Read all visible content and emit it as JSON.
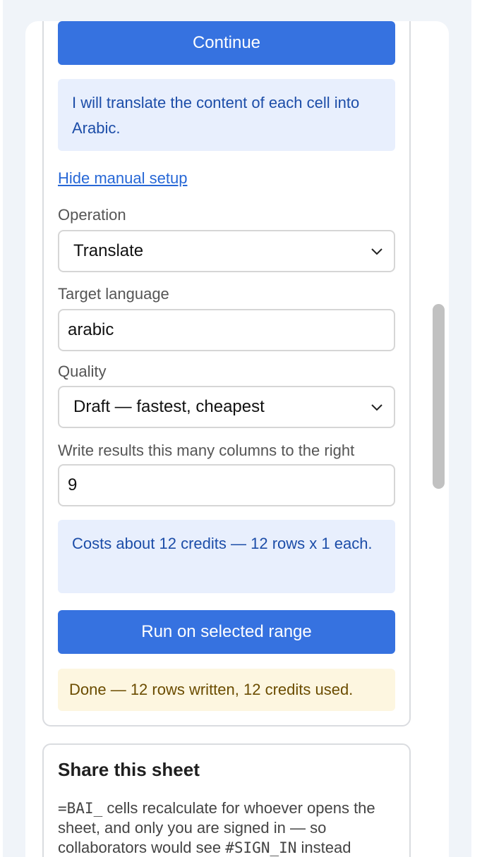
{
  "manual": {
    "continue_label": "Continue",
    "info_text": "I will translate the content of each cell into Arabic.",
    "hide_link": "Hide manual setup",
    "operation_label": "Operation",
    "operation_value": "Translate",
    "target_language_label": "Target language",
    "target_language_value": "arabic",
    "quality_label": "Quality",
    "quality_value": "Draft — fastest, cheapest",
    "offset_label": "Write results this many columns to the right",
    "offset_value": "9",
    "cost_text": "Costs about 12 credits — 12 rows x 1 each.",
    "run_label": "Run on selected range",
    "done_text": "Done — 12 rows written, 12 credits used."
  },
  "share": {
    "title": "Share this sheet",
    "body_code1": "=BAI_",
    "body_text1": " cells recalculate for whoever opens the sheet, and only you are signed in — so collaborators would see ",
    "body_code2": "#SIGN_IN",
    "body_text2": " instead"
  },
  "colors": {
    "primary": "#3672e0",
    "info_bg": "#e8effd",
    "done_bg": "#fdf6e0"
  },
  "icons": {
    "select_chevron": "chevron-down-icon"
  }
}
